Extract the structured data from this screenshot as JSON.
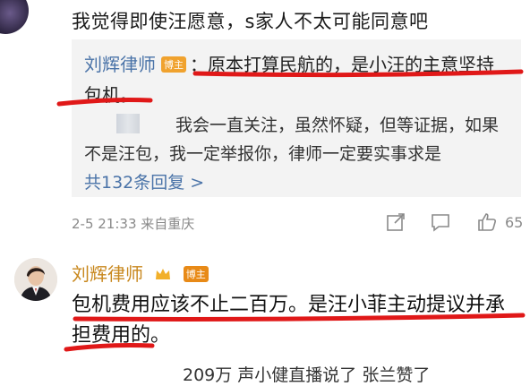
{
  "top_comment": {
    "text": "我觉得即使汪愿意，s家人不太可能同意吧"
  },
  "reply": {
    "author": "刘辉律师",
    "badge": "博主",
    "text_part1": "：原本打算民航的，是小汪的主意坚持",
    "text_part2": "包机。",
    "nested_text": "我会一直关注，虽然怀疑，但等证据，如果不是汪包，我一定举报你，律师一定要实事求是",
    "more_link": "共132条回复 >"
  },
  "meta": {
    "time": "2-5 21:33",
    "source": "来自重庆",
    "likes": "65"
  },
  "comment2": {
    "author": "刘辉律师",
    "badge": "博主",
    "text": "包机费用应该不止二百万。是汪小菲主动提议并承担费用的。"
  },
  "next_comment_partial": "209万 声小健直播说了 张兰赞了"
}
